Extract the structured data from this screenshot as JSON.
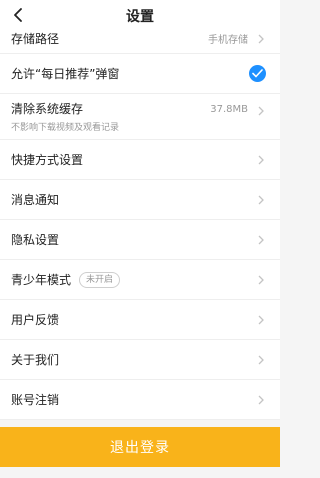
{
  "header": {
    "title": "设置"
  },
  "rows": [
    {
      "label": "存储路径",
      "value": "手机存储",
      "kind": "chevron"
    },
    {
      "label": "允许“每日推荐”弹窗",
      "kind": "check"
    },
    {
      "label": "清除系统缓存",
      "sub": "不影响下载视频及观看记录",
      "value": "37.8MB",
      "kind": "chevron"
    },
    {
      "label": "快捷方式设置",
      "kind": "chevron"
    },
    {
      "label": "消息通知",
      "kind": "chevron"
    },
    {
      "label": "隐私设置",
      "kind": "chevron"
    },
    {
      "label": "青少年模式",
      "badge": "未开启",
      "kind": "chevron"
    },
    {
      "label": "用户反馈",
      "kind": "chevron"
    },
    {
      "label": "关于我们",
      "kind": "chevron"
    },
    {
      "label": "账号注销",
      "kind": "chevron"
    }
  ],
  "footer": {
    "logout_label": "退出登录"
  },
  "colors": {
    "accent": "#f9b31a",
    "check": "#1e90ff"
  }
}
